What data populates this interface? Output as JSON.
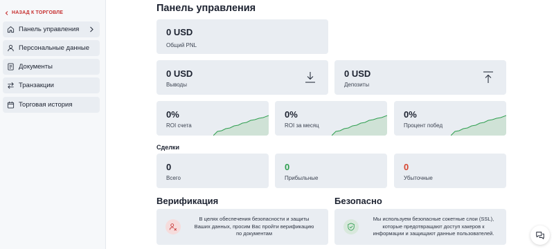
{
  "sidebar": {
    "back_label": "НАЗАД К ТОРГОВЛЕ",
    "items": [
      {
        "label": "Панель управления",
        "icon": "home-icon"
      },
      {
        "label": "Персональные данные",
        "icon": "user-icon"
      },
      {
        "label": "Документы",
        "icon": "document-icon"
      },
      {
        "label": "Транзакции",
        "icon": "transfer-icon"
      },
      {
        "label": "Торговая история",
        "icon": "calendar-icon"
      }
    ]
  },
  "main": {
    "title": "Панель управления",
    "pnl": {
      "value": "0 USD",
      "label": "Общий PNL"
    },
    "withdrawals": {
      "value": "0 USD",
      "label": "Выводы"
    },
    "deposits": {
      "value": "0 USD",
      "label": "Депозиты"
    },
    "roi_account": {
      "value": "0%",
      "label": "ROI счета"
    },
    "roi_month": {
      "value": "0%",
      "label": "ROI за месяц"
    },
    "win_rate": {
      "value": "0%",
      "label": "Процент побед"
    },
    "trades": {
      "section_label": "Сделки",
      "total": {
        "value": "0",
        "label": "Всего"
      },
      "profitable": {
        "value": "0",
        "label": "Прибыльные"
      },
      "losing": {
        "value": "0",
        "label": "Убыточные"
      }
    },
    "verification": {
      "title": "Верификация",
      "text": "В целях обеспечения безопасности и защиты Ваших данных, просим Вас пройти верификацию по документам"
    },
    "security": {
      "title": "Безопасно",
      "text": "Мы используем безопасные сокетные слои (SSL), которые предотвращают доступ хакеров к информации и защищают данные пользователей."
    }
  },
  "colors": {
    "accent_red": "#c62f2f",
    "positive_green": "#2e9e4f",
    "negative_red": "#d6452f",
    "card_bg": "#e9edf2"
  }
}
